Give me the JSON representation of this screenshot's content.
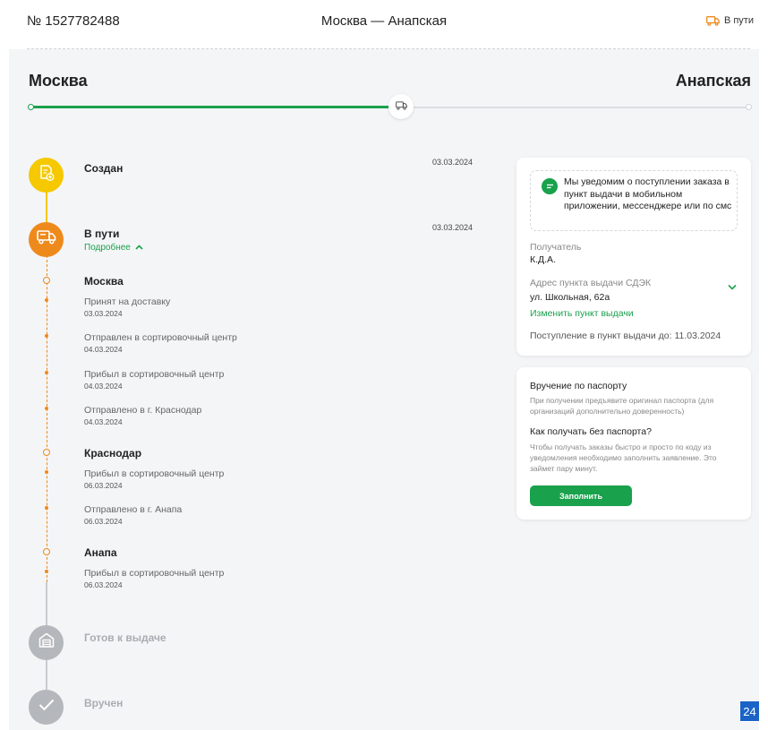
{
  "header": {
    "order_number": "№ 1527782488",
    "route": "Москва — Анапская",
    "status": "В пути"
  },
  "route": {
    "from": "Москва",
    "to": "Анапская",
    "progress_fraction": 0.5
  },
  "stages": [
    {
      "title": "Создан",
      "date": "03.03.2024"
    },
    {
      "title": "В пути",
      "date": "03.03.2024",
      "details_label": "Подробнее"
    },
    {
      "title": "Готов к выдаче"
    },
    {
      "title": "Вручен"
    }
  ],
  "transit": [
    {
      "city": "Москва",
      "events": [
        {
          "text": "Принят на доставку",
          "date": "03.03.2024"
        },
        {
          "text": "Отправлен в сортировочный центр",
          "date": "04.03.2024"
        },
        {
          "text": "Прибыл в сортировочный центр",
          "date": "04.03.2024"
        },
        {
          "text": "Отправлено в г. Краснодар",
          "date": "04.03.2024"
        }
      ]
    },
    {
      "city": "Краснодар",
      "events": [
        {
          "text": "Прибыл в сортировочный центр",
          "date": "06.03.2024"
        },
        {
          "text": "Отправлено в г. Анапа",
          "date": "06.03.2024"
        }
      ]
    },
    {
      "city": "Анапа",
      "events": [
        {
          "text": "Прибыл в сортировочный центр",
          "date": "06.03.2024"
        }
      ]
    }
  ],
  "delivery_card": {
    "notice": "Мы уведомим о поступлении заказа в пункт выдачи в мобильном приложении, мессенджере или по смс",
    "recipient_label": "Получатель",
    "recipient_value": "К.Д.А.",
    "address_label": "Адрес пункта выдачи СДЭК",
    "address_value": "ул. Школьная, 62а",
    "change_link": "Изменить пункт выдачи",
    "arrival": "Поступление в пункт выдачи до: 11.03.2024"
  },
  "passport_card": {
    "title": "Вручение по паспорту",
    "description": "При получении предъявите оригинал паспорта (для организаций дополнительно доверенность)",
    "question": "Как получать без паспорта?",
    "question_description": "Чтобы получать заказы быстро и просто по коду из уведомления необходимо заполнить заявление. Это займет пару минут.",
    "button_label": "Заполнить"
  },
  "badge": "24",
  "colors": {
    "accent_green": "#1aa14c",
    "created_yellow": "#f5c800",
    "transit_orange": "#ee8a1c",
    "inactive_gray": "#b4b7bb",
    "badge_blue": "#1b63c6"
  },
  "icons": {
    "status": "truck-icon",
    "created": "document-plus-icon",
    "transit": "truck-icon",
    "ready": "pickup-point-icon",
    "delivered": "check-icon",
    "notice": "chat-icon",
    "details": "chevron-up-icon",
    "address": "chevron-down-icon"
  }
}
